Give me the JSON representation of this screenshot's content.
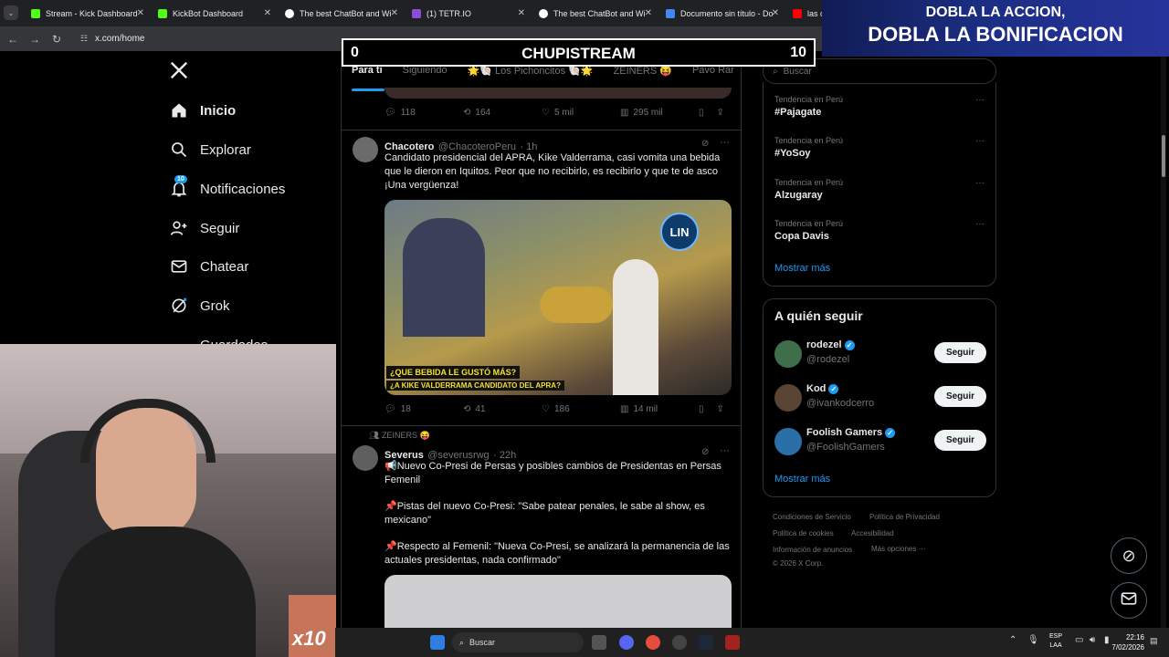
{
  "browser": {
    "tabs": [
      {
        "title": "Stream - Kick Dashboard",
        "color": "#53fc18"
      },
      {
        "title": "KickBot Dashboard",
        "color": "#53fc18"
      },
      {
        "title": "The best ChatBot and Wi",
        "color": "#ffffff"
      },
      {
        "title": "(1) TETR.IO",
        "color": "#8c4dd6"
      },
      {
        "title": "The best ChatBot and Wi",
        "color": "#ffffff"
      },
      {
        "title": "Documento sin título - Do",
        "color": "#4285f4"
      },
      {
        "title": "las div",
        "color": "#ff0000"
      }
    ],
    "url": "x.com/home"
  },
  "sidebar": {
    "items": [
      {
        "label": "Inicio",
        "icon": "home-icon"
      },
      {
        "label": "Explorar",
        "icon": "search-icon"
      },
      {
        "label": "Notificaciones",
        "icon": "bell-icon",
        "badge": "10"
      },
      {
        "label": "Seguir",
        "icon": "follow-icon"
      },
      {
        "label": "Chatear",
        "icon": "mail-icon"
      },
      {
        "label": "Grok",
        "icon": "grok-icon"
      },
      {
        "label": "Guardados",
        "icon": "bookmark-icon"
      }
    ]
  },
  "feed": {
    "tabs": [
      "Para ti",
      "Siguiendo",
      "🌟🐚 Los Pichoncitos 🐚🌟",
      "ZEINERS 😝",
      "Pavo Rar"
    ],
    "post1_stats": {
      "replies": "118",
      "reposts": "164",
      "likes": "5 mil",
      "views": "295 mil"
    },
    "post2": {
      "name": "Chacotero",
      "handle": "@ChacoteroPeru",
      "time": "· 1h",
      "text": "Candidato presidencial del APRA, Kike Valderrama, casi vomita una bebida que le dieron en Iquitos. Peor que no recibirlo, es recibirlo y que te de asco ¡Una vergüenza!",
      "caption1": "¿QUE BEBIDA LE GUSTÓ  MÁS?",
      "caption2": "¿A KIKE VALDERRAMA CANDIDATO DEL APRA?",
      "logo": "LIN",
      "stats": {
        "replies": "18",
        "reposts": "41",
        "likes": "186",
        "views": "14 mil"
      }
    },
    "post3": {
      "community": "ZEINERS 😝",
      "name": "Severus",
      "handle": "@severusrwg",
      "time": "· 22h",
      "line1": "📢Nuevo Co-Presi de Persas y posibles cambios de Presidentas en Persas Femenil",
      "line2": "📌Pistas del nuevo Co-Presi: \"Sabe patear penales, le sabe al show, es mexicano\"",
      "line3": "📌Respecto al Femenil: \"Nueva Co-Presi, se analizará la permanencia de las actuales presidentas, nada confirmado\""
    }
  },
  "right": {
    "search_placeholder": "Buscar",
    "trends": [
      {
        "context": "Tendencia en Perú",
        "name": "#Pajagate"
      },
      {
        "context": "Tendencia en Perú",
        "name": "#YoSoy"
      },
      {
        "context": "Tendencia en Perú",
        "name": "Alzugaray"
      },
      {
        "context": "Tendencia en Perú",
        "name": "Copa Davis"
      }
    ],
    "show_more": "Mostrar más",
    "who_to_follow_title": "A quién seguir",
    "follow": [
      {
        "name": "rodezel",
        "handle": "@rodezel",
        "button": "Seguir"
      },
      {
        "name": "Kod",
        "handle": "@ivankodcerro",
        "button": "Seguir"
      },
      {
        "name": "Foolish Gamers",
        "handle": "@FoolishGamers",
        "button": "Seguir"
      }
    ],
    "show_more_2": "Mostrar más",
    "footer": [
      "Condiciones de Servicio",
      "Política de Privacidad",
      "Política de cookies",
      "Accesibilidad",
      "Información de anuncios",
      "Más opciones ···",
      "© 2026 X Corp."
    ]
  },
  "overlay": {
    "score_left": "0",
    "score_title": "CHUPISTREAM",
    "score_right": "10",
    "promo_line1": "DOBLA LA ACCION,",
    "promo_line2": "DOBLA LA BONIFICACION",
    "multiplier": "x10"
  },
  "taskbar": {
    "search": "Buscar",
    "lang1": "ESP",
    "lang2": "LAA",
    "time": "22:16",
    "date": "7/02/2026"
  }
}
